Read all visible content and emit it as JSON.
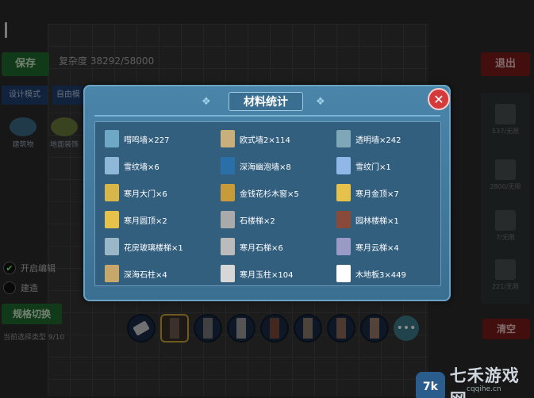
{
  "hud": {
    "save": "保存",
    "complexity": "复杂度 38292/58000",
    "design_mode": "设计模式",
    "free_mode": "自由模",
    "exit": "退出",
    "clear": "清空",
    "switch": "规格切换",
    "check1": "开启编辑",
    "check2": "建造",
    "toolbar_hint": "当前选择类型 9/10",
    "left_icon1": "建筑物",
    "left_icon2": "地面装饰"
  },
  "right_panel": {
    "items": [
      {
        "label": "537/无限"
      },
      {
        "label": "2800/无限"
      },
      {
        "label": "7/无限"
      },
      {
        "label": "221/无限"
      }
    ]
  },
  "dialog": {
    "title": "材料统计",
    "close": "✕",
    "items": [
      {
        "label": "嘒鸣墙×227",
        "color": "#6fa7c7"
      },
      {
        "label": "欧式墙2×114",
        "color": "#c9b07a"
      },
      {
        "label": "透明墙×242",
        "color": "#7fa7b7"
      },
      {
        "label": "雪纹墙×6",
        "color": "#8fb7d7"
      },
      {
        "label": "深海幽泡墙×8",
        "color": "#2a6fa7"
      },
      {
        "label": "雪纹门×1",
        "color": "#8fb7e7"
      },
      {
        "label": "寒月大门×6",
        "color": "#d7b74a"
      },
      {
        "label": "金钱花杉木窗×5",
        "color": "#c79a3a"
      },
      {
        "label": "寒月金顶×7",
        "color": "#e7c24a"
      },
      {
        "label": "寒月圆顶×2",
        "color": "#e7c24a"
      },
      {
        "label": "石楼梯×2",
        "color": "#aaaaaa"
      },
      {
        "label": "园林楼梯×1",
        "color": "#8a4a3a"
      },
      {
        "label": "花房玻璃楼梯×1",
        "color": "#9ab7c7"
      },
      {
        "label": "寒月石梯×6",
        "color": "#bbbbbb"
      },
      {
        "label": "寒月云梯×4",
        "color": "#9a9ac7"
      },
      {
        "label": "深海石柱×4",
        "color": "#c7a76a"
      },
      {
        "label": "寒月玉柱×104",
        "color": "#d7d7d7"
      },
      {
        "label": "木地板3×449",
        "color": "#ffffff"
      }
    ]
  },
  "watermark": {
    "logo": "7k",
    "text": "七禾游戏网",
    "sub": "cqqihe.cn"
  },
  "colors": {
    "accent": "#4a85a9",
    "close": "#d43a3a"
  }
}
